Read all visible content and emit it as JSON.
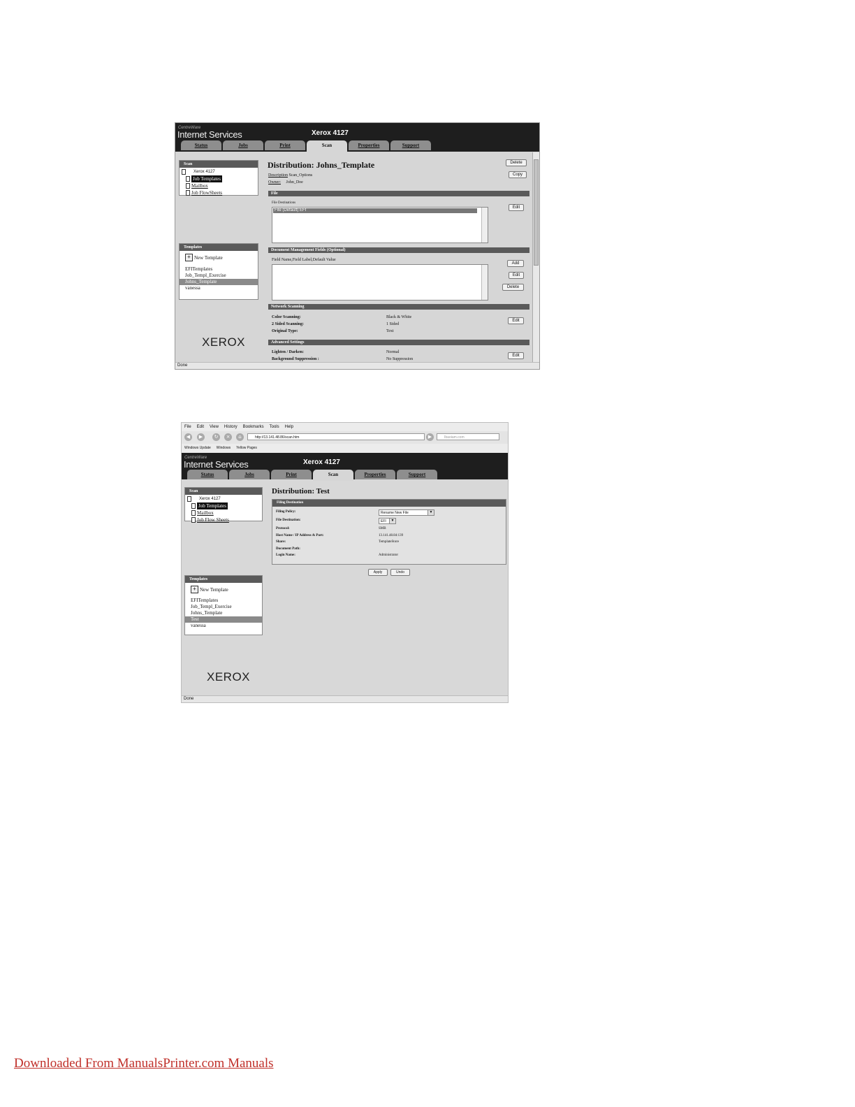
{
  "screen1": {
    "brand_small": "CentreWare",
    "brand": "Internet Services",
    "device": "Xerox 4127",
    "tabs": [
      "Status",
      "Jobs",
      "Print",
      "Scan",
      "Properties",
      "Support"
    ],
    "active_tab": "Scan",
    "scan_panel": {
      "header": "Scan",
      "root": "Xerox 4127",
      "items": [
        "Job Templates",
        "Mailbox",
        "Job FlowSheets"
      ],
      "selected": "Job Templates"
    },
    "templates_panel": {
      "header": "Templates",
      "new_template": "New Template",
      "items": [
        "EFITemplates",
        "Job_Templ_Exercise",
        "Johns_Template",
        "vanessa"
      ],
      "highlighted": "Johns_Template"
    },
    "logo": "XEROX",
    "status": "Done",
    "title": "Distribution: Johns_Template",
    "buttons": {
      "delete": "Delete",
      "copy": "Copy",
      "edit": "Edit",
      "add": "Add"
    },
    "description_label": "Description",
    "description_value": "Scan_Options",
    "owner_label": "Owner:",
    "owner_value": "John_Doe",
    "sections": {
      "file": "File",
      "doc_mgmt": "Document Management Fields (Optional)",
      "network": "Network Scanning",
      "advanced": "Advanced Settings"
    },
    "file_destinations_label": "File Destinations",
    "file_destinations": [
      "File (Default) EFI"
    ],
    "doc_mgmt_columns": "Field Name,Field Label,Default Value",
    "network_rows": [
      {
        "label": "Color Scanning:",
        "value": "Black & White"
      },
      {
        "label": "2 Sided Scanning:",
        "value": "1 Sided"
      },
      {
        "label": "Original Type:",
        "value": "Text"
      }
    ],
    "advanced_rows": [
      {
        "label": "Lighten / Darken:",
        "value": "Normal"
      },
      {
        "label": "Background Suppression :",
        "value": "No Suppression"
      }
    ]
  },
  "screen2": {
    "menu": [
      "File",
      "Edit",
      "View",
      "History",
      "Bookmarks",
      "Tools",
      "Help"
    ],
    "url": "http://13.141.48.86/scan.htm",
    "search_placeholder": "Ibaoiam.com",
    "bookmarks": [
      "Windows Update",
      "Windows",
      "Yellow Pages"
    ],
    "brand_small": "CentreWare",
    "brand": "Internet Services",
    "device": "Xerox 4127",
    "tabs": [
      "Status",
      "Jobs",
      "Print",
      "Scan",
      "Properties",
      "Support"
    ],
    "active_tab": "Scan",
    "scan_panel": {
      "header": "Scan",
      "root": "Xerox 4127",
      "items": [
        "Job Templates",
        "Mailbox",
        "Job Flow Sheets"
      ],
      "selected": "Job Templates"
    },
    "templates_panel": {
      "header": "Templates",
      "new_template": "New Template",
      "items": [
        "EFITemplates",
        "Job_Templ_Exercise",
        "Johns_Template",
        "Test",
        "vanessa"
      ],
      "highlighted": "Test"
    },
    "logo": "XEROX",
    "status": "Done",
    "title": "Distribution: Test",
    "section": "Filing Destination",
    "rows": [
      {
        "label": "Filing Policy:",
        "value": "Rename New File"
      },
      {
        "label": "File Destination:",
        "value": "EFI"
      },
      {
        "label": "Protocol:",
        "value": "SMB"
      },
      {
        "label": "Host Name / IP Address & Port:",
        "value": "13.141.48.84:139"
      },
      {
        "label": "Share:",
        "value": "TemplateStore"
      },
      {
        "label": "Document Path:",
        "value": ""
      },
      {
        "label": "Login Name:",
        "value": "Administrator"
      }
    ],
    "apply": "Apply",
    "undo": "Undo"
  },
  "footer_link": "Downloaded From ManualsPrinter.com Manuals"
}
